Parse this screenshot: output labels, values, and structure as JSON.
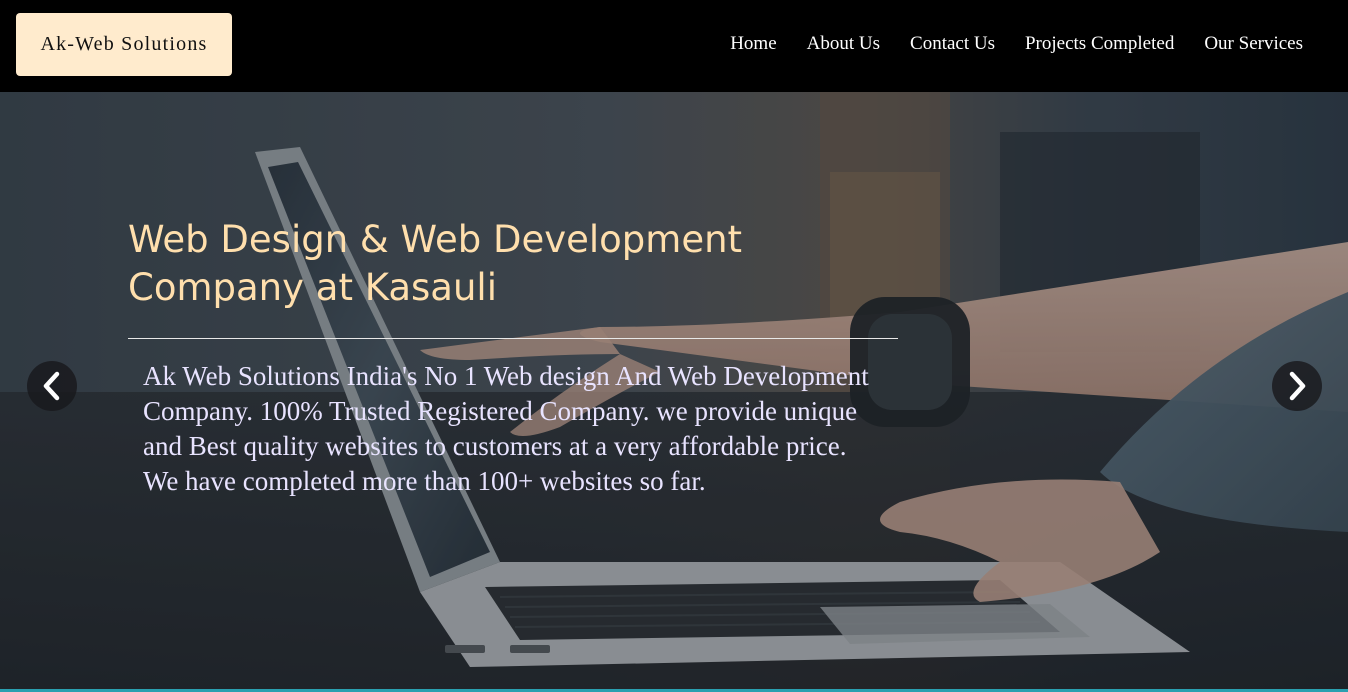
{
  "header": {
    "logo_text": "Ak-Web Solutions",
    "nav": [
      {
        "label": "Home"
      },
      {
        "label": "About Us"
      },
      {
        "label": "Contact Us"
      },
      {
        "label": "Projects Completed"
      },
      {
        "label": "Our Services"
      }
    ]
  },
  "hero": {
    "title": "Web Design & Web Development Company at Kasauli",
    "description": "Ak Web Solutions India's No 1 Web design And Web Development Company. 100% Trusted Registered Company. we provide unique and Best quality websites to customers at a very affordable price. We have completed more than 100+ websites so far.",
    "prev_icon": "chevron-left-icon",
    "next_icon": "chevron-right-icon"
  },
  "colors": {
    "header_bg": "#000000",
    "logo_bg": "#ffebcd",
    "title_color": "#ffdfad",
    "text_color": "#e8e3ff",
    "accent_strip": "#2aa0b0"
  }
}
